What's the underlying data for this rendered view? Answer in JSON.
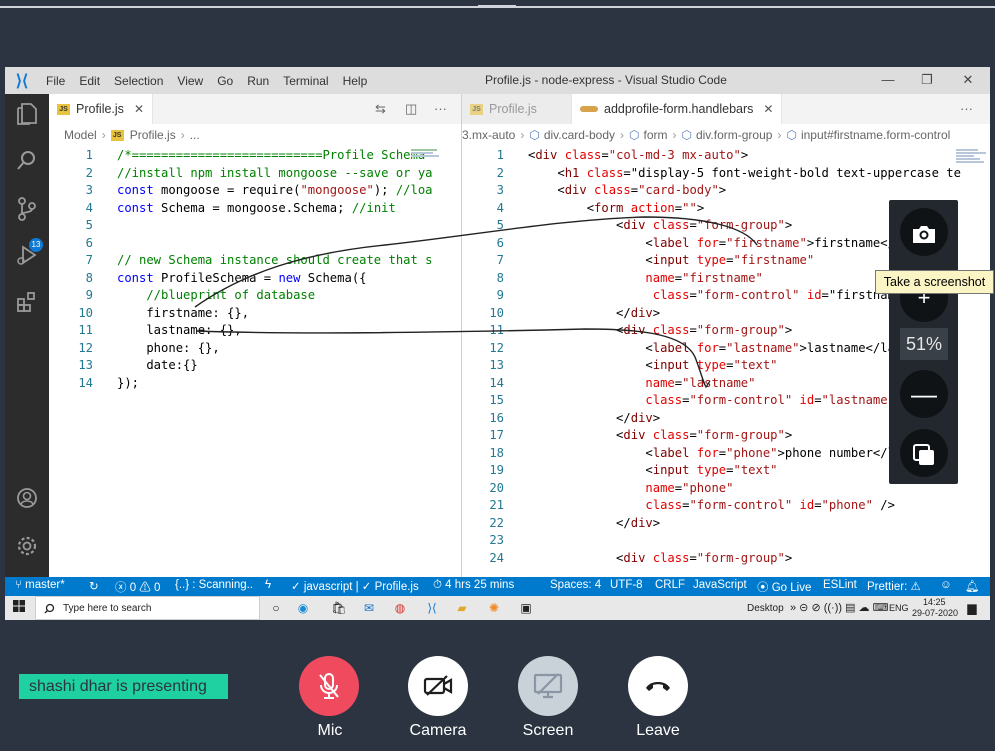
{
  "vscode": {
    "menu": [
      "File",
      "Edit",
      "Selection",
      "View",
      "Go",
      "Run",
      "Terminal",
      "Help"
    ],
    "window_title": "Profile.js - node-express - Visual Studio Code",
    "scm_badge": "13",
    "left_pane": {
      "tab_label": "Profile.js",
      "tab_badge": "JS",
      "breadcrumb": [
        "Model",
        "Profile.js",
        "..."
      ],
      "lines": [
        {
          "n": "1",
          "text": "/*==========================Profile Schema"
        },
        {
          "n": "2",
          "text": "//install npm install mongoose --save or ya"
        },
        {
          "n": "3",
          "text": "const mongoose = require(\"mongoose\"); //loa"
        },
        {
          "n": "4",
          "text": "const Schema = mongoose.Schema; //init"
        },
        {
          "n": "5",
          "text": ""
        },
        {
          "n": "6",
          "text": ""
        },
        {
          "n": "7",
          "text": "// new Schema instance should create that s"
        },
        {
          "n": "8",
          "text": "const ProfileSchema = new Schema({"
        },
        {
          "n": "9",
          "text": "    //blueprint of database"
        },
        {
          "n": "10",
          "text": "    firstname: {},"
        },
        {
          "n": "11",
          "text": "    lastname: {},"
        },
        {
          "n": "12",
          "text": "    phone: {},"
        },
        {
          "n": "13",
          "text": "    date:{}"
        },
        {
          "n": "14",
          "text": "});"
        }
      ]
    },
    "right_pane": {
      "tab_inactive_label": "Profile.js",
      "tab_active_label": "addprofile-form.handlebars",
      "breadcrumb": [
        "3.mx-auto",
        "div.card-body",
        "form",
        "div.form-group",
        "input#firstname.form-control"
      ],
      "lines": [
        {
          "n": "1",
          "text": "<div class=\"col-md-3 mx-auto\">"
        },
        {
          "n": "2",
          "text": "    <h1 class=\"display-5 font-weight-bold text-uppercase te"
        },
        {
          "n": "3",
          "text": "    <div class=\"card-body\">"
        },
        {
          "n": "4",
          "text": "        <form action=\"\">"
        },
        {
          "n": "5",
          "text": "            <div class=\"form-group\">"
        },
        {
          "n": "6",
          "text": "                <label for=\"firstname\">firstname</la"
        },
        {
          "n": "7",
          "text": "                <input type=\"firstname\""
        },
        {
          "n": "8",
          "text": "                name=\"firstname\""
        },
        {
          "n": "9",
          "text": "                 class=\"form-control\" id=\"firstname"
        },
        {
          "n": "10",
          "text": "            </div>"
        },
        {
          "n": "11",
          "text": "            <div class=\"form-group\">"
        },
        {
          "n": "12",
          "text": "                <label for=\"lastname\">lastname</labe"
        },
        {
          "n": "13",
          "text": "                <input type=\"text\""
        },
        {
          "n": "14",
          "text": "                name=\"lastname\""
        },
        {
          "n": "15",
          "text": "                class=\"form-control\" id=\"lastname\" /"
        },
        {
          "n": "16",
          "text": "            </div>"
        },
        {
          "n": "17",
          "text": "            <div class=\"form-group\">"
        },
        {
          "n": "18",
          "text": "                <label for=\"phone\">phone number</la"
        },
        {
          "n": "19",
          "text": "                <input type=\"text\""
        },
        {
          "n": "20",
          "text": "                name=\"phone\""
        },
        {
          "n": "21",
          "text": "                class=\"form-control\" id=\"phone\" />"
        },
        {
          "n": "22",
          "text": "            </div>"
        },
        {
          "n": "23",
          "text": ""
        },
        {
          "n": "24",
          "text": "            <div class=\"form-group\">"
        }
      ]
    },
    "status": {
      "branch": "master*",
      "errors": "0",
      "warnings": "0",
      "scanning": "{..} : Scanning..",
      "language_check": "javascript",
      "file_check": "Profile.js",
      "time": "4 hrs 25 mins",
      "spaces": "Spaces: 4",
      "encoding": "UTF-8",
      "eol": "CRLF",
      "language": "JavaScript",
      "go_live": "Go Live",
      "eslint": "ESLint",
      "prettier": "Prettier:"
    }
  },
  "taskbar": {
    "search_placeholder": "Type here to search",
    "desktop_label": "Desktop",
    "lang": "ENG",
    "time": "14:25",
    "date": "29-07-2020"
  },
  "zoom": {
    "level": "51%",
    "tooltip": "Take a screenshot"
  },
  "meeting": {
    "presenter": "shashi dhar is presenting",
    "controls": {
      "mic": "Mic",
      "camera": "Camera",
      "screen": "Screen",
      "leave": "Leave"
    },
    "colors": {
      "mic": "#ef4a5e",
      "camera": "#ffffff",
      "screen": "#c9d1d9",
      "leave": "#ffffff",
      "presenter_badge": "#1fd1a0"
    }
  }
}
